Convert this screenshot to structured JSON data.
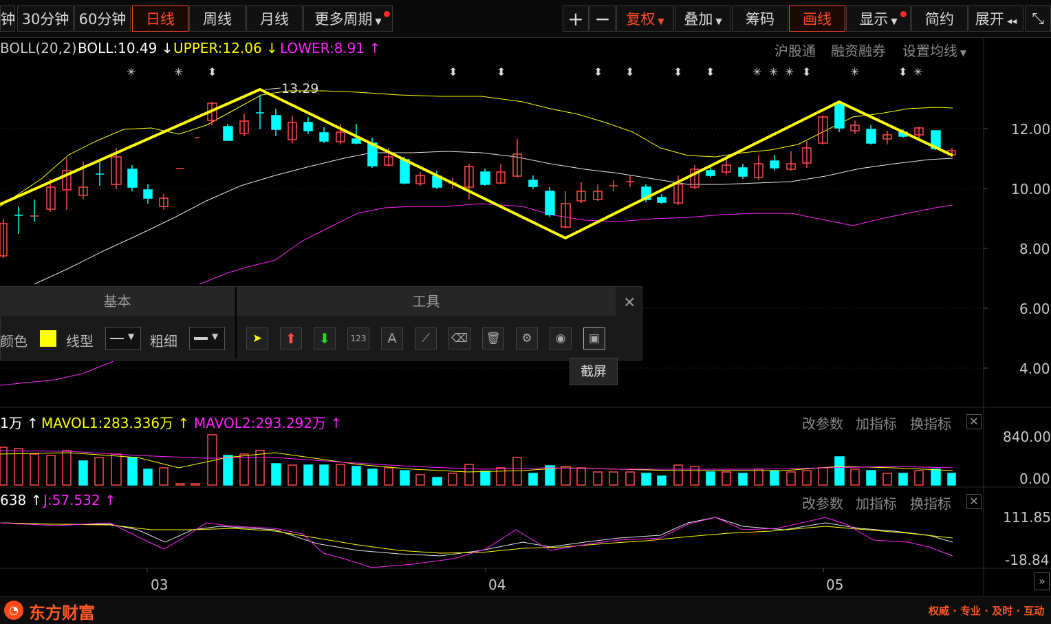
{
  "toolbar": {
    "periods": [
      "钟",
      "30分钟",
      "60分钟",
      "日线",
      "周线",
      "月线",
      "更多周期"
    ],
    "plus": "+",
    "minus": "−",
    "fuquan": "复权",
    "diejia": "叠加",
    "chouma": "筹码",
    "huaxian": "画线",
    "xianshi": "显示",
    "jianyue": "简约",
    "zhankai": "展开"
  },
  "boll": {
    "name": "BOLL(20,2)",
    "boll": "BOLL:10.49",
    "upper": "UPPER:12.06",
    "lower": "LOWER:8.91",
    "links": [
      "沪股通",
      "融资融券",
      "设置均线"
    ],
    "peak_label": "13.29",
    "colors": {
      "upper": "#ffff00",
      "lower": "#ff22ff",
      "mid": "#e6e6e6",
      "up": "#ff4a4a",
      "down": "#00ffff",
      "trend": "#ffff00"
    }
  },
  "price_axis": [
    "12.00",
    "10.00",
    "8.00",
    "6.00",
    "4.00"
  ],
  "vol": {
    "vol": "1万",
    "mavol1": "MAVOL1:283.336万",
    "mavol2": "MAVOL2:293.292万",
    "axis": [
      "840.00",
      "0.00"
    ],
    "links": [
      "改参数",
      "加指标",
      "换指标"
    ]
  },
  "kdj": {
    "d": "638",
    "j": "J:57.532",
    "axis": [
      "111.85",
      "-18.84"
    ],
    "links": [
      "改参数",
      "加指标",
      "换指标"
    ]
  },
  "x_axis": [
    "03",
    "04",
    "05"
  ],
  "draw_panel": {
    "basic_title": "基本",
    "tools_title": "工具",
    "color_label": "颜色",
    "line_type_label": "线型",
    "thickness_label": "粗细",
    "tooltip": "截屏",
    "swatch_color": "#ffff00"
  },
  "footer": {
    "brand": "东方财富",
    "slogan": "权威 · 专业 · 及时 · 互动"
  }
}
